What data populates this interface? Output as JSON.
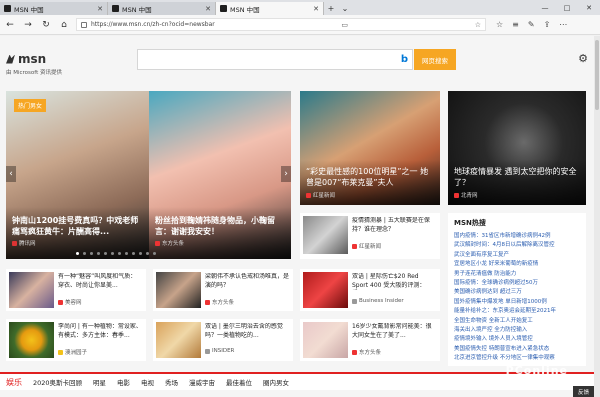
{
  "tabs": [
    {
      "title": "MSN 中国",
      "active": false
    },
    {
      "title": "MSN 中国",
      "active": false
    },
    {
      "title": "MSN 中国",
      "active": true
    }
  ],
  "address": {
    "url": "https://www.msn.cn/zh-cn?ocid=newsbar"
  },
  "header": {
    "logo": "msn",
    "powered": "由 Microsoft 资讯提供",
    "search_button": "网页搜索"
  },
  "hero": {
    "badge": "热门男女",
    "items": [
      {
        "title": "钟南山1200挂号费真吗？中戏老师痛骂疯狂黄牛：片酬高得...",
        "source": "腾讯网"
      },
      {
        "title": "粉丝拾到鞠婧祎随身物品，小鞠留言：谢谢我安安！",
        "source": "东方头条"
      }
    ]
  },
  "top_cards": [
    {
      "title": "“彩史最性感的100位明星”之一 她曾是007“布莱克曼”夫人",
      "source": "红星新闻"
    },
    {
      "title": "地球疫情暴发 遇到太空把你的安全了？",
      "source": "北青网"
    }
  ],
  "mid_card": {
    "title": "疫情猜测暴 | 五大联赛是在保持？谁在理念？",
    "source": "红星新闻"
  },
  "small_items": [
    {
      "title": "有一种“魅容”叫风度和气质：穿衣、时尚让你显美...",
      "source": "美容网"
    },
    {
      "title": "梁朝伟不承认色戒和汤唯真，是演的吗？",
      "source": "东方头条"
    },
    {
      "title": "双语 | 星际伤亡$20 Red Sport 400 受大阪的评测：受...",
      "source": "Business Insider"
    },
    {
      "title": "李尚问 | 有一种植物：常设家、有模式：多方主体：春季...",
      "source": "澳洲园子"
    },
    {
      "title": "双语 | 墨尔三明治去含的感觉吗？一类植物吃的...",
      "source": "INSIDER"
    },
    {
      "title": "16岁少女戴背影常问能美：很大同女生在了美了...",
      "source": "东方头条"
    }
  ],
  "hot_list": {
    "title": "MSN热搜",
    "items": [
      "国内疫情：31省区市新增确诊病例42例",
      "武汉解封时间：4月8日以后解除离汉管控",
      "武汉全面有序复工复产",
      "宜居地区小龙 好来米葡萄的新疫情",
      "男子连花清瘟做 防治能力",
      "国际疫情：全球确诊病例超过50万",
      "美国确诊病例达到 超过三万",
      "国外疫情集中爆发地 单日新增1000例",
      "能量补给补之：东京奥运会延期至2021年",
      "全国生命物资 全新工人开始复工",
      "海关出入境严控 全力防控输入",
      "疫情境外输入 境外人员入境管控",
      "美国疫情失控 特朗普宣布进入紧急状态",
      "北京进京管控升级 不分地区一律集中观察"
    ]
  },
  "categories": {
    "main": "娱乐",
    "items": [
      "2020奥斯卡回顾",
      "明星",
      "电影",
      "电视",
      "秀场",
      "漫威宇宙",
      "最佳着位",
      "圈内男女"
    ]
  },
  "feedback": "反馈",
  "watermark": "PConline"
}
